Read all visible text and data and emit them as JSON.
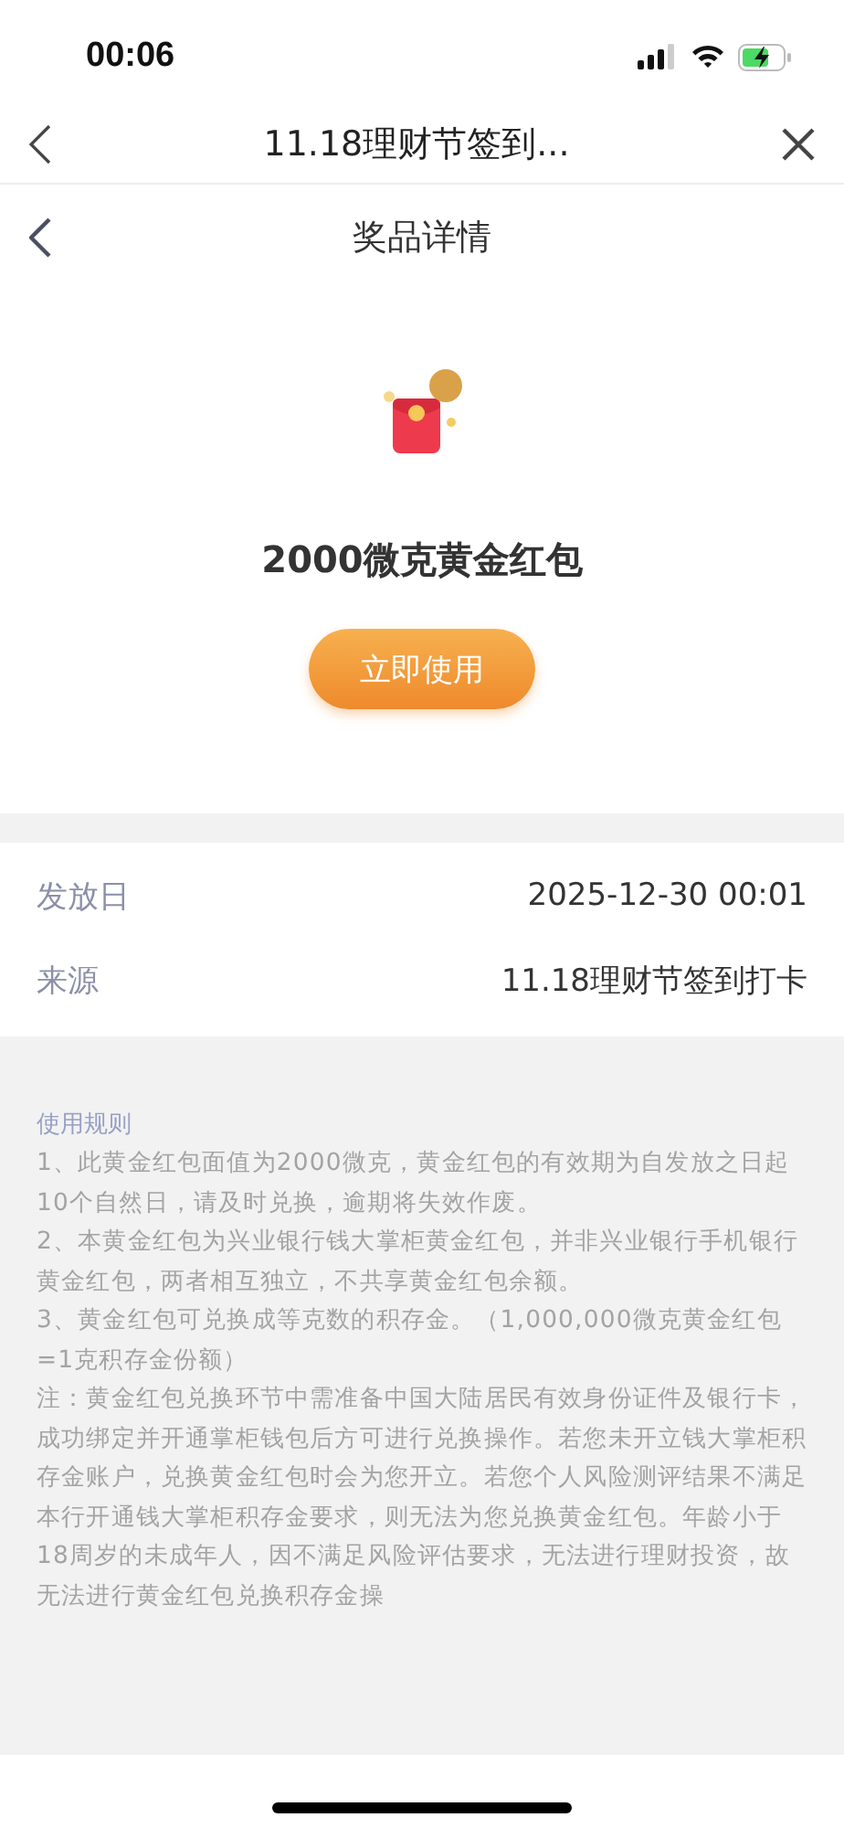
{
  "status_bar": {
    "time": "00:06"
  },
  "webview_bar": {
    "title": "11.18理财节签到..."
  },
  "header": {
    "title": "奖品详情"
  },
  "prize": {
    "name": "2000微克黄金红包",
    "button": "立即使用"
  },
  "details": [
    {
      "label": "发放日",
      "value": "2025-12-30 00:01"
    },
    {
      "label": "来源",
      "value": "11.18理财节签到打卡"
    }
  ],
  "rules": {
    "title": "使用规则",
    "paragraphs": [
      "1、此黄金红包面值为2000微克，黄金红包的有效期为自发放之日起10个自然日，请及时兑换，逾期将失效作废。",
      "2、本黄金红包为兴业银行钱大掌柜黄金红包，并非兴业银行手机银行黄金红包，两者相互独立，不共享黄金红包余额。",
      "3、黄金红包可兑换成等克数的积存金。（1,000,000微克黄金红包=1克积存金份额）",
      "注：黄金红包兑换环节中需准备中国大陆居民有效身份证件及银行卡，成功绑定并开通掌柜钱包后方可进行兑换操作。若您未开立钱大掌柜积存金账户，兑换黄金红包时会为您开立。若您个人风险测评结果不满足本行开通钱大掌柜积存金要求，则无法为您兑换黄金红包。年龄小于18周岁的未成年人，因不满足风险评估要求，无法进行理财投资，故无法进行黄金红包兑换积存金操"
    ]
  }
}
